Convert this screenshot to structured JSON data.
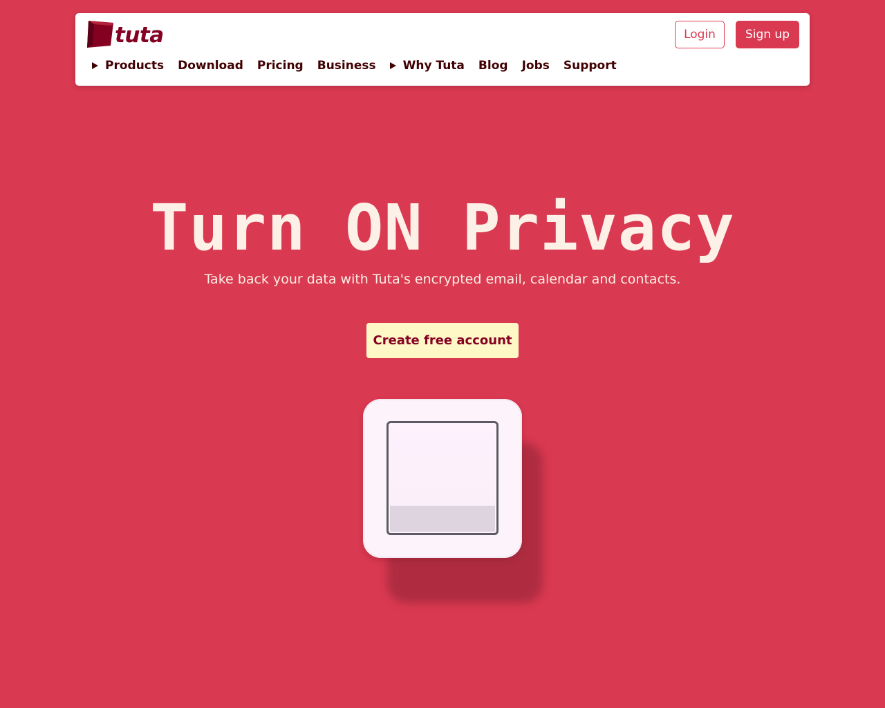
{
  "header": {
    "logo_text": "tuta",
    "login_label": "Login",
    "signup_label": "Sign up",
    "nav": [
      {
        "label": "Products",
        "dropdown": true
      },
      {
        "label": "Download",
        "dropdown": false
      },
      {
        "label": "Pricing",
        "dropdown": false
      },
      {
        "label": "Business",
        "dropdown": false
      },
      {
        "label": "Why Tuta",
        "dropdown": true
      },
      {
        "label": "Blog",
        "dropdown": false
      },
      {
        "label": "Jobs",
        "dropdown": false
      },
      {
        "label": "Support",
        "dropdown": false
      }
    ]
  },
  "hero": {
    "title": "Turn ON Privacy",
    "subtitle": "Take back your data with Tuta's encrypted email, calendar and contacts.",
    "cta_label": "Create free account"
  },
  "icons": {
    "logo": "tuta-logo-icon",
    "dropdown": "caret-right-icon",
    "switch": "light-switch-icon"
  },
  "colors": {
    "background": "#d93951",
    "brand_dark": "#850122",
    "nav_text": "#410002",
    "cta_bg": "#fdf8c6",
    "hero_text": "#fdf0e6"
  }
}
